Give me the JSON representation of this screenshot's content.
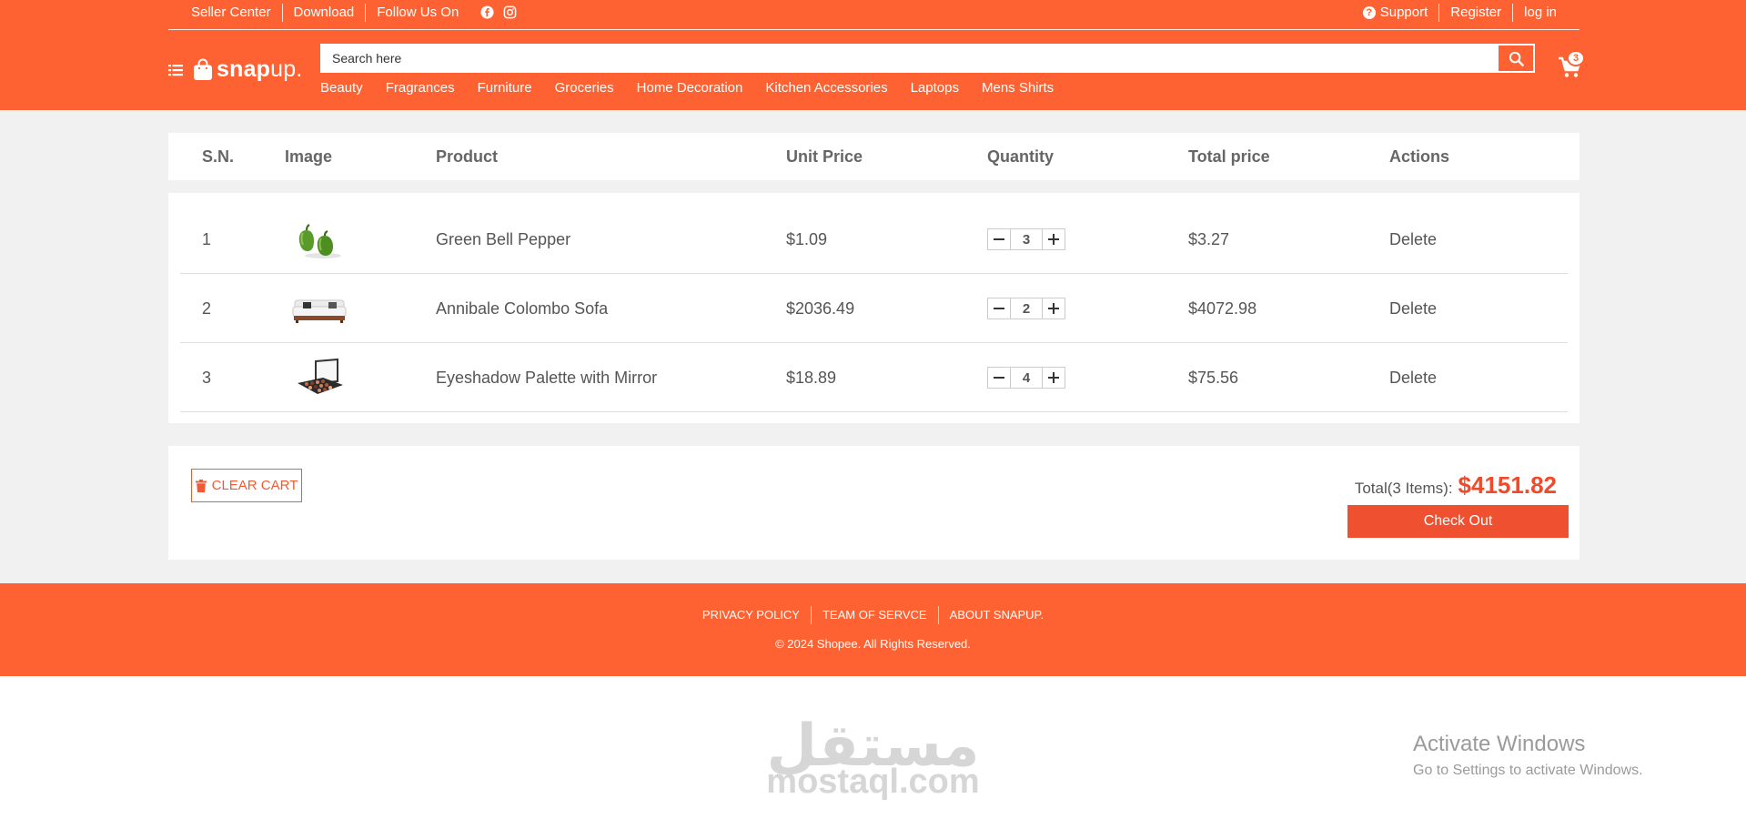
{
  "topbar": {
    "seller_center": "Seller Center",
    "download": "Download",
    "follow_us": "Follow Us On",
    "social_icons": [
      "facebook-icon",
      "instagram-icon"
    ],
    "support": "Support",
    "register": "Register",
    "login": "log in"
  },
  "brand": {
    "logo_bold": "snap",
    "logo_light": "up."
  },
  "search": {
    "placeholder": "Search here",
    "value": ""
  },
  "categories": [
    "Beauty",
    "Fragrances",
    "Furniture",
    "Groceries",
    "Home Decoration",
    "Kitchen Accessories",
    "Laptops",
    "Mens Shirts"
  ],
  "cart": {
    "count": "3"
  },
  "table": {
    "headers": [
      "S.N.",
      "Image",
      "Product",
      "Unit Price",
      "Quantity",
      "Total price",
      "Actions"
    ],
    "rows": [
      {
        "sn": "1",
        "image": "green-bell-pepper-image",
        "product": "Green Bell Pepper",
        "unit_price": "$1.09",
        "quantity": "3",
        "total": "$3.27",
        "action": "Delete"
      },
      {
        "sn": "2",
        "image": "sofa-image",
        "product": "Annibale Colombo Sofa",
        "unit_price": "$2036.49",
        "quantity": "2",
        "total": "$4072.98",
        "action": "Delete"
      },
      {
        "sn": "3",
        "image": "eyeshadow-palette-image",
        "product": "Eyeshadow Palette with Mirror",
        "unit_price": "$18.89",
        "quantity": "4",
        "total": "$75.56",
        "action": "Delete"
      }
    ]
  },
  "summary": {
    "clear_cart": "CLEAR CART",
    "total_label": "Total(3 Items):",
    "total_amount": "$4151.82",
    "checkout": "Check Out"
  },
  "footer": {
    "links": [
      "PRIVACY POLICY",
      "TEAM OF SERVCE",
      "ABOUT SNAPUP."
    ],
    "copyright": "© 2024 Shopee. All Rights Reserved."
  },
  "watermark": {
    "arabic": "مستقل",
    "latin": "mostaql.com"
  },
  "os_notice": {
    "title": "Activate Windows",
    "subtitle": "Go to Settings to activate Windows."
  },
  "colors": {
    "brand": "#fe6232",
    "accent_red": "#ef4a2b",
    "page_bg": "#f1f1f1"
  }
}
